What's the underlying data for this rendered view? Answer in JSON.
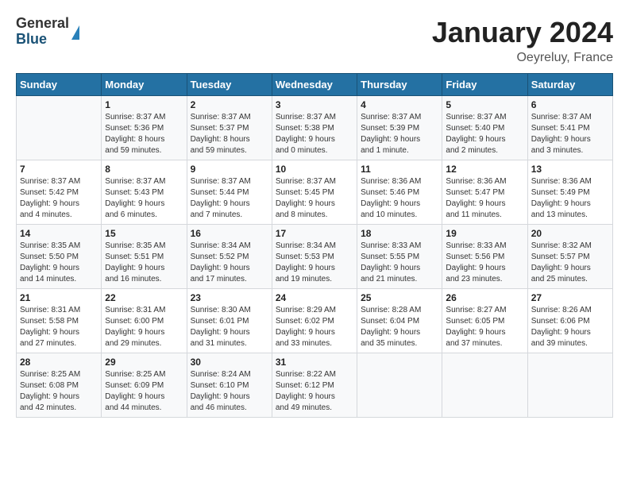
{
  "header": {
    "logo_general": "General",
    "logo_blue": "Blue",
    "title": "January 2024",
    "subtitle": "Oeyreluy, France"
  },
  "weekdays": [
    "Sunday",
    "Monday",
    "Tuesday",
    "Wednesday",
    "Thursday",
    "Friday",
    "Saturday"
  ],
  "weeks": [
    [
      {
        "day": "",
        "info": ""
      },
      {
        "day": "1",
        "info": "Sunrise: 8:37 AM\nSunset: 5:36 PM\nDaylight: 8 hours\nand 59 minutes."
      },
      {
        "day": "2",
        "info": "Sunrise: 8:37 AM\nSunset: 5:37 PM\nDaylight: 8 hours\nand 59 minutes."
      },
      {
        "day": "3",
        "info": "Sunrise: 8:37 AM\nSunset: 5:38 PM\nDaylight: 9 hours\nand 0 minutes."
      },
      {
        "day": "4",
        "info": "Sunrise: 8:37 AM\nSunset: 5:39 PM\nDaylight: 9 hours\nand 1 minute."
      },
      {
        "day": "5",
        "info": "Sunrise: 8:37 AM\nSunset: 5:40 PM\nDaylight: 9 hours\nand 2 minutes."
      },
      {
        "day": "6",
        "info": "Sunrise: 8:37 AM\nSunset: 5:41 PM\nDaylight: 9 hours\nand 3 minutes."
      }
    ],
    [
      {
        "day": "7",
        "info": "Sunrise: 8:37 AM\nSunset: 5:42 PM\nDaylight: 9 hours\nand 4 minutes."
      },
      {
        "day": "8",
        "info": "Sunrise: 8:37 AM\nSunset: 5:43 PM\nDaylight: 9 hours\nand 6 minutes."
      },
      {
        "day": "9",
        "info": "Sunrise: 8:37 AM\nSunset: 5:44 PM\nDaylight: 9 hours\nand 7 minutes."
      },
      {
        "day": "10",
        "info": "Sunrise: 8:37 AM\nSunset: 5:45 PM\nDaylight: 9 hours\nand 8 minutes."
      },
      {
        "day": "11",
        "info": "Sunrise: 8:36 AM\nSunset: 5:46 PM\nDaylight: 9 hours\nand 10 minutes."
      },
      {
        "day": "12",
        "info": "Sunrise: 8:36 AM\nSunset: 5:47 PM\nDaylight: 9 hours\nand 11 minutes."
      },
      {
        "day": "13",
        "info": "Sunrise: 8:36 AM\nSunset: 5:49 PM\nDaylight: 9 hours\nand 13 minutes."
      }
    ],
    [
      {
        "day": "14",
        "info": "Sunrise: 8:35 AM\nSunset: 5:50 PM\nDaylight: 9 hours\nand 14 minutes."
      },
      {
        "day": "15",
        "info": "Sunrise: 8:35 AM\nSunset: 5:51 PM\nDaylight: 9 hours\nand 16 minutes."
      },
      {
        "day": "16",
        "info": "Sunrise: 8:34 AM\nSunset: 5:52 PM\nDaylight: 9 hours\nand 17 minutes."
      },
      {
        "day": "17",
        "info": "Sunrise: 8:34 AM\nSunset: 5:53 PM\nDaylight: 9 hours\nand 19 minutes."
      },
      {
        "day": "18",
        "info": "Sunrise: 8:33 AM\nSunset: 5:55 PM\nDaylight: 9 hours\nand 21 minutes."
      },
      {
        "day": "19",
        "info": "Sunrise: 8:33 AM\nSunset: 5:56 PM\nDaylight: 9 hours\nand 23 minutes."
      },
      {
        "day": "20",
        "info": "Sunrise: 8:32 AM\nSunset: 5:57 PM\nDaylight: 9 hours\nand 25 minutes."
      }
    ],
    [
      {
        "day": "21",
        "info": "Sunrise: 8:31 AM\nSunset: 5:58 PM\nDaylight: 9 hours\nand 27 minutes."
      },
      {
        "day": "22",
        "info": "Sunrise: 8:31 AM\nSunset: 6:00 PM\nDaylight: 9 hours\nand 29 minutes."
      },
      {
        "day": "23",
        "info": "Sunrise: 8:30 AM\nSunset: 6:01 PM\nDaylight: 9 hours\nand 31 minutes."
      },
      {
        "day": "24",
        "info": "Sunrise: 8:29 AM\nSunset: 6:02 PM\nDaylight: 9 hours\nand 33 minutes."
      },
      {
        "day": "25",
        "info": "Sunrise: 8:28 AM\nSunset: 6:04 PM\nDaylight: 9 hours\nand 35 minutes."
      },
      {
        "day": "26",
        "info": "Sunrise: 8:27 AM\nSunset: 6:05 PM\nDaylight: 9 hours\nand 37 minutes."
      },
      {
        "day": "27",
        "info": "Sunrise: 8:26 AM\nSunset: 6:06 PM\nDaylight: 9 hours\nand 39 minutes."
      }
    ],
    [
      {
        "day": "28",
        "info": "Sunrise: 8:25 AM\nSunset: 6:08 PM\nDaylight: 9 hours\nand 42 minutes."
      },
      {
        "day": "29",
        "info": "Sunrise: 8:25 AM\nSunset: 6:09 PM\nDaylight: 9 hours\nand 44 minutes."
      },
      {
        "day": "30",
        "info": "Sunrise: 8:24 AM\nSunset: 6:10 PM\nDaylight: 9 hours\nand 46 minutes."
      },
      {
        "day": "31",
        "info": "Sunrise: 8:22 AM\nSunset: 6:12 PM\nDaylight: 9 hours\nand 49 minutes."
      },
      {
        "day": "",
        "info": ""
      },
      {
        "day": "",
        "info": ""
      },
      {
        "day": "",
        "info": ""
      }
    ]
  ]
}
